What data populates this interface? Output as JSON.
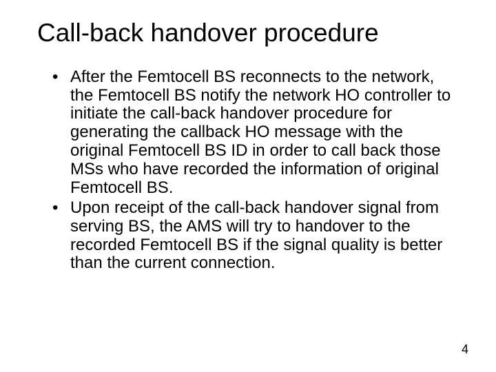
{
  "slide": {
    "title": "Call-back handover procedure",
    "bullets": [
      "After the Femtocell BS reconnects to the network, the Femtocell BS notify the network HO controller to initiate the call-back handover procedure for generating the callback HO message with the original Femtocell BS ID in order to call back those MSs who have recorded the information of original Femtocell BS.",
      "Upon receipt of the call-back handover signal from serving BS, the AMS will try to handover to the recorded Femtocell BS if the signal quality is better than the current connection."
    ],
    "page_number": "4"
  }
}
